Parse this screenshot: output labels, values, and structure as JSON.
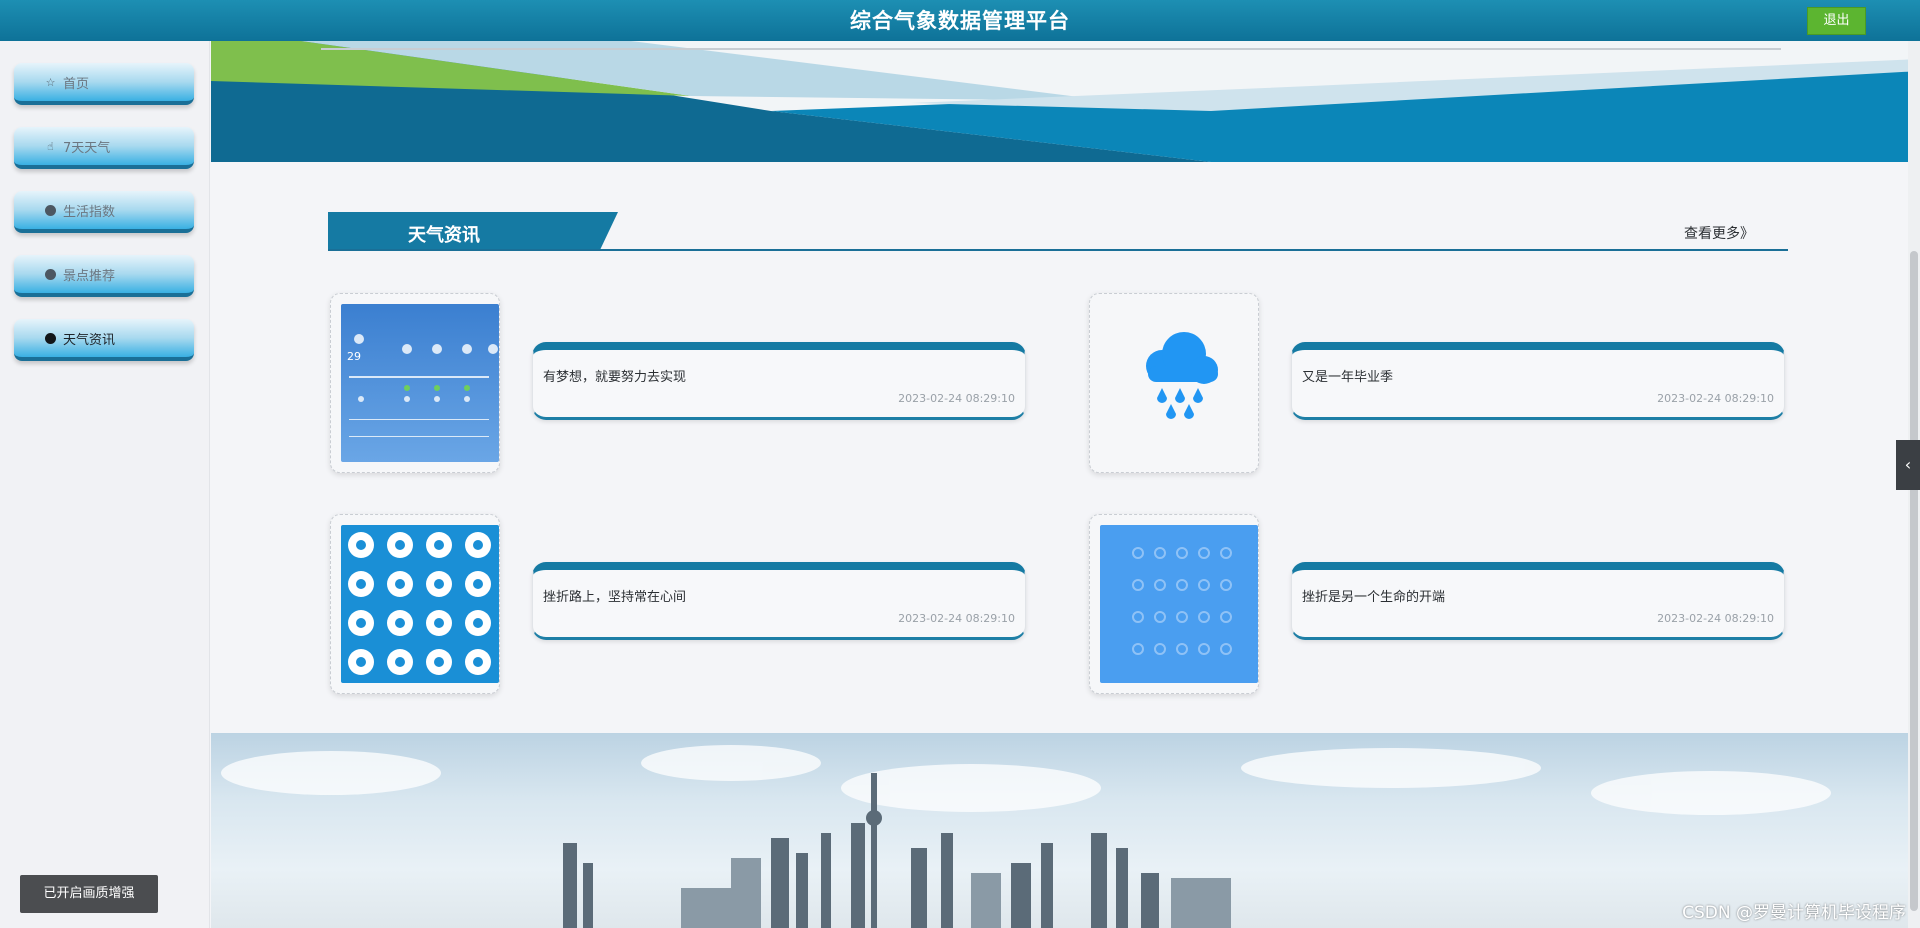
{
  "header": {
    "title": "综合气象数据管理平台",
    "logout_label": "退出"
  },
  "sidebar": {
    "items": [
      {
        "label": "首页",
        "icon": "star-icon"
      },
      {
        "label": "7天天气",
        "icon": "hand-icon"
      },
      {
        "label": "生活指数",
        "icon": "dot-icon"
      },
      {
        "label": "景点推荐",
        "icon": "dot-icon"
      },
      {
        "label": "天气资讯",
        "icon": "info-icon"
      }
    ],
    "active": "天气资讯"
  },
  "news": {
    "section_title": "天气资讯",
    "more_label": "查看更多》",
    "items": [
      {
        "title": "有梦想，就要努力去实现",
        "date": "2023-02-24 08:29:10",
        "image": "weather-app-screenshot"
      },
      {
        "title": "又是一年毕业季",
        "date": "2023-02-24 08:29:10",
        "image": "rain-cloud-icon"
      },
      {
        "title": "挫折路上，坚持常在心间",
        "date": "2023-02-24 08:29:10",
        "image": "weather-icons-grid"
      },
      {
        "title": "挫折是另一个生命的开端",
        "date": "2023-02-24 08:29:10",
        "image": "weather-icons-panel"
      }
    ]
  },
  "overlay": {
    "toast": "已开启画质增强",
    "watermark": "CSDN @罗曼计算机毕设程序"
  },
  "colors": {
    "header": "#0e7298",
    "accent": "#157aa3",
    "logout": "#5cb530",
    "rain_icon": "#2196f3"
  }
}
